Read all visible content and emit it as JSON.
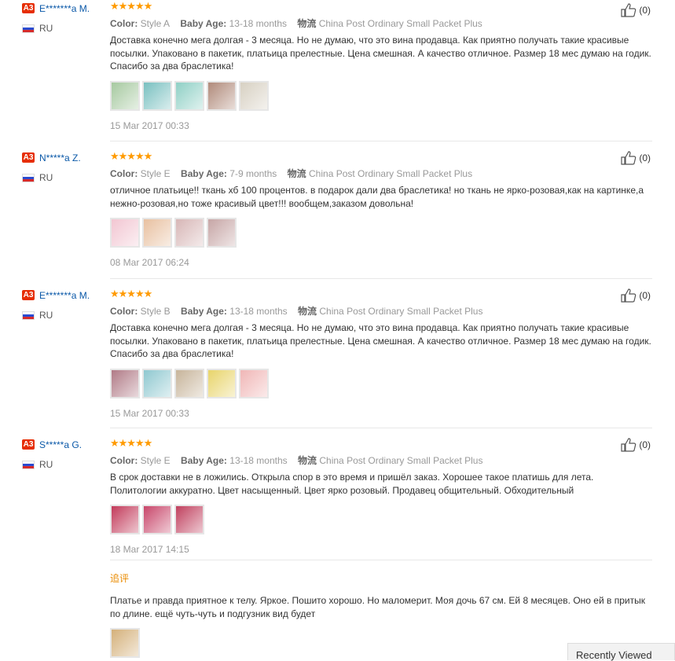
{
  "labels": {
    "color": "Color:",
    "age": "Baby Age:",
    "ship": "物流"
  },
  "colors": {
    "stars": "#ff9a00",
    "username": "#0a58a8",
    "level_badge": "#e62e04",
    "additional_label": "#ea8b00"
  },
  "reviews": [
    {
      "level": "A3",
      "user": "E*******a M.",
      "country": "RU",
      "stars": "★★★★★",
      "color": "Style A",
      "age": "13-18 months",
      "shipping": "China Post Ordinary Small Packet Plus",
      "text": "Доставка конечно мега долгая - 3 месяца. Но не думаю, что это вина продавца. Как приятно получать такие красивые посылки. Упаковано в пакетик, платьица прелестные. Цена смешная. А качество отличное. Размер 18 мес думаю на годик. Спасибо за два браслетика!",
      "date": "15 Mar 2017 00:33",
      "helpful": "(0)",
      "photos": [
        "#a6c9a0",
        "#79c0c0",
        "#8fd0c5",
        "#b08a7a",
        "#d7d0c2"
      ]
    },
    {
      "level": "A3",
      "user": "N*****a Z.",
      "country": "RU",
      "stars": "★★★★★",
      "color": "Style E",
      "age": "7-9 months",
      "shipping": "China Post Ordinary Small Packet Plus",
      "text": "отличное платьице!! ткань хб 100 процентов. в подарок дали два браслетика! но ткань не ярко-розовая,как на картинке,а нежно-розовая,но тоже красивый цвет!!! вообщем,заказом довольна!",
      "date": "08 Mar 2017 06:24",
      "helpful": "(0)",
      "photos": [
        "#f2c6d2",
        "#e8c0a0",
        "#d7b6b6",
        "#c6a5a5"
      ]
    },
    {
      "level": "A3",
      "user": "E*******a M.",
      "country": "RU",
      "stars": "★★★★★",
      "color": "Style B",
      "age": "13-18 months",
      "shipping": "China Post Ordinary Small Packet Plus",
      "text": "Доставка конечно мега долгая - 3 месяца. Но не думаю, что это вина продавца. Как приятно получать такие красивые посылки. Упаковано в пакетик, платьица прелестные. Цена смешная. А качество отличное. Размер 18 мес думаю на годик. Спасибо за два браслетика!",
      "date": "15 Mar 2017 00:33",
      "helpful": "(0)",
      "photos": [
        "#b07a86",
        "#8fc8d0",
        "#c7b49a",
        "#e8d46a",
        "#f0b6b6"
      ]
    },
    {
      "level": "A3",
      "user": "S*****a G.",
      "country": "RU",
      "stars": "★★★★★",
      "color": "Style E",
      "age": "13-18 months",
      "shipping": "China Post Ordinary Small Packet Plus",
      "text": "В срок доставки не в ложились. Открыла спор в это время и пришёл заказ. Хорошее такое платишь для лета. Политологии аккуратно. Цвет насыщенный. Цвет ярко розовый. Продавец общительный. Обходительный",
      "date": "18 Mar 2017 14:15",
      "helpful": "(0)",
      "photos": [
        "#c23a5a",
        "#c8466a",
        "#c0405e"
      ],
      "additional": {
        "label": "追评",
        "text": "Платье и правда приятное к телу. Яркое. Пошито хорошо. Но маломерит. Моя дочь 67 см. Ей 8 месяцев. Оно ей в притык по длине. ещё чуть-чуть и подгузник вид будет",
        "photos": [
          "#d4b07a"
        ]
      }
    }
  ],
  "recently_viewed": "Recently Viewed"
}
